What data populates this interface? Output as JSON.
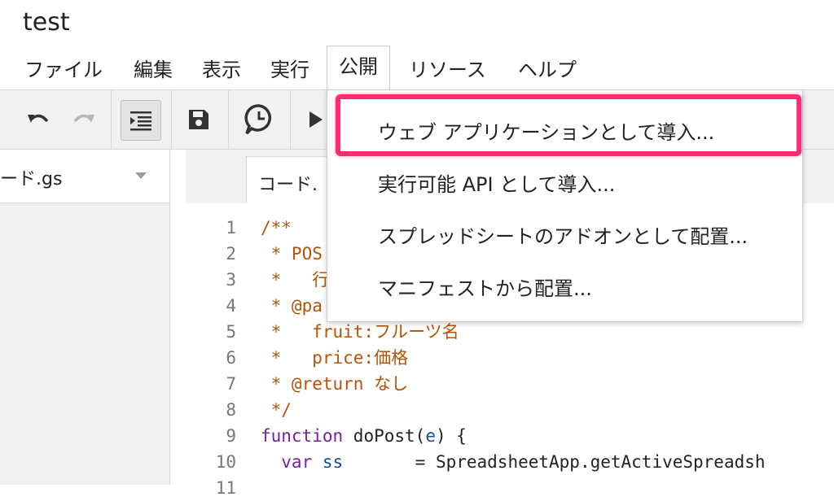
{
  "app": {
    "title": "test"
  },
  "menubar": {
    "items": [
      "ファイル",
      "編集",
      "表示",
      "実行",
      "公開",
      "リソース",
      "ヘルプ"
    ]
  },
  "toolbar": {
    "undo_icon": "undo-icon",
    "redo_icon": "redo-icon",
    "indent_icon": "indent-icon",
    "save_icon": "save-icon",
    "triggers_icon": "clock-icon",
    "run_icon": "play-icon"
  },
  "sidebar": {
    "file_name": "ード.gs"
  },
  "editor": {
    "tab_label": "コード.",
    "line_numbers": [
      "1",
      "2",
      "3",
      "4",
      "5",
      "6",
      "7",
      "8",
      "9",
      "10",
      "11"
    ],
    "code": {
      "l1": "/**",
      "l2": " * POS",
      "l3": " *   ",
      "l3b": "行",
      "l4": " * @pa",
      "l5": " *   fruit:フルーツ名",
      "l6": " *   price:価格",
      "l7": " * @return なし",
      "l8": " */",
      "l9_kw": "function",
      "l9_rest": " doPost(",
      "l9_param": "e",
      "l9_end": ") {",
      "l10_kw": "  var",
      "l10_var": " ss",
      "l10_rest": "       = SpreadsheetApp.getActiveSpreadsh"
    }
  },
  "publish_menu": {
    "items": [
      "ウェブ アプリケーションとして導入...",
      "実行可能 API として導入...",
      "スプレッドシートのアドオンとして配置...",
      "マニフェストから配置..."
    ],
    "highlight_color": "#ff2d6f"
  }
}
